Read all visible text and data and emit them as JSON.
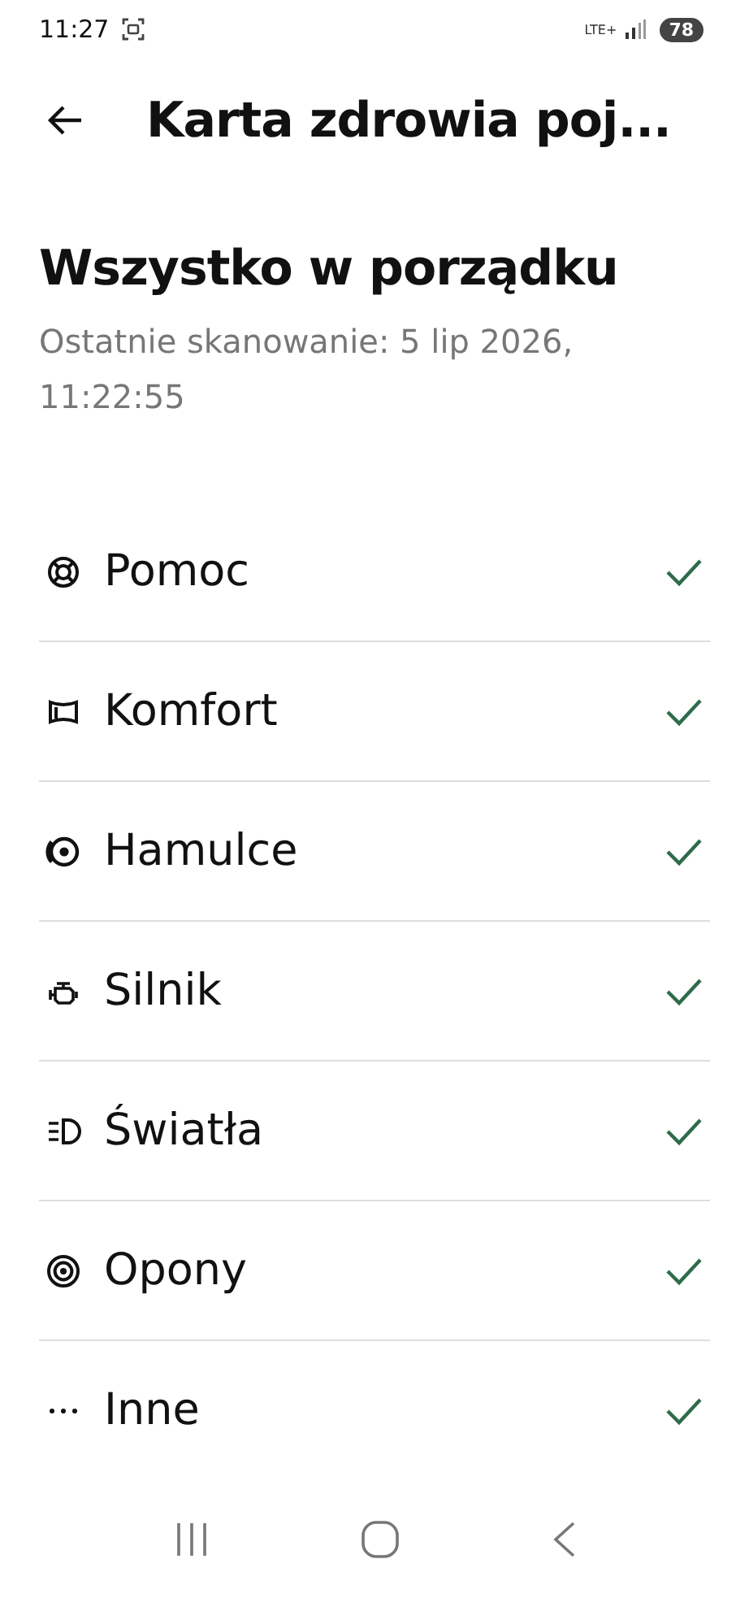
{
  "status_bar": {
    "time": "11:27",
    "network": "LTE+",
    "battery": "78"
  },
  "header": {
    "title": "Karta zdrowia poj..."
  },
  "summary": {
    "heading": "Wszystko w porządku",
    "subtitle": "Ostatnie skanowanie: 5 lip 2026, 11:22:55"
  },
  "items": [
    {
      "kind": "lifebuoy",
      "label": "Pomoc",
      "checked": true
    },
    {
      "kind": "seat",
      "label": "Komfort",
      "checked": true
    },
    {
      "kind": "brake",
      "label": "Hamulce",
      "checked": true
    },
    {
      "kind": "engine",
      "label": "Silnik",
      "checked": true
    },
    {
      "kind": "light",
      "label": "Światła",
      "checked": true
    },
    {
      "kind": "tyre",
      "label": "Opony",
      "checked": true
    },
    {
      "kind": "more",
      "label": "Inne",
      "checked": true
    }
  ]
}
